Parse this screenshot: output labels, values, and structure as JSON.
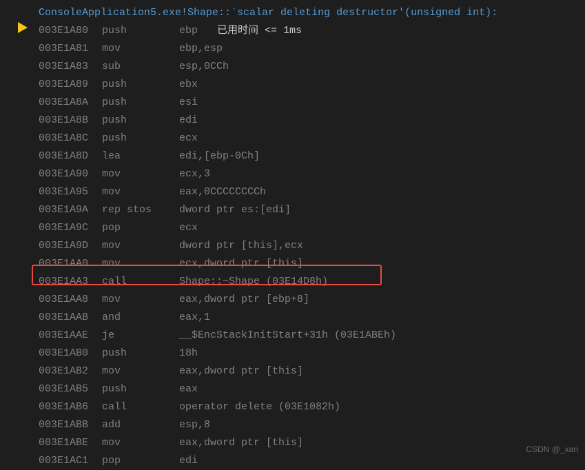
{
  "header": "ConsoleApplication5.exe!Shape::`scalar deleting destructor'(unsigned int):",
  "annotation": "已用时间 <= 1ms",
  "watermark": "CSDN @_xan",
  "rows": [
    {
      "addr": "003E1A80",
      "mn": "push",
      "op": "ebp"
    },
    {
      "addr": "003E1A81",
      "mn": "mov",
      "op": "ebp,esp"
    },
    {
      "addr": "003E1A83",
      "mn": "sub",
      "op": "esp,0CCh"
    },
    {
      "addr": "003E1A89",
      "mn": "push",
      "op": "ebx"
    },
    {
      "addr": "003E1A8A",
      "mn": "push",
      "op": "esi"
    },
    {
      "addr": "003E1A8B",
      "mn": "push",
      "op": "edi"
    },
    {
      "addr": "003E1A8C",
      "mn": "push",
      "op": "ecx"
    },
    {
      "addr": "003E1A8D",
      "mn": "lea",
      "op": "edi,[ebp-0Ch]"
    },
    {
      "addr": "003E1A90",
      "mn": "mov",
      "op": "ecx,3"
    },
    {
      "addr": "003E1A95",
      "mn": "mov",
      "op": "eax,0CCCCCCCCh"
    },
    {
      "addr": "003E1A9A",
      "mn": "rep stos",
      "op": "dword ptr es:[edi]"
    },
    {
      "addr": "003E1A9C",
      "mn": "pop",
      "op": "ecx"
    },
    {
      "addr": "003E1A9D",
      "mn": "mov",
      "op": "dword ptr [this],ecx"
    },
    {
      "addr": "003E1AA0",
      "mn": "mov",
      "op": "ecx,dword ptr [this]"
    },
    {
      "addr": "003E1AA3",
      "mn": "call",
      "op": "Shape::~Shape (03E14D8h)"
    },
    {
      "addr": "003E1AA8",
      "mn": "mov",
      "op": "eax,dword ptr [ebp+8]"
    },
    {
      "addr": "003E1AAB",
      "mn": "and",
      "op": "eax,1"
    },
    {
      "addr": "003E1AAE",
      "mn": "je",
      "op": "__$EncStackInitStart+31h (03E1ABEh)"
    },
    {
      "addr": "003E1AB0",
      "mn": "push",
      "op": "18h"
    },
    {
      "addr": "003E1AB2",
      "mn": "mov",
      "op": "eax,dword ptr [this]"
    },
    {
      "addr": "003E1AB5",
      "mn": "push",
      "op": "eax"
    },
    {
      "addr": "003E1AB6",
      "mn": "call",
      "op": "operator delete (03E1082h)"
    },
    {
      "addr": "003E1ABB",
      "mn": "add",
      "op": "esp,8"
    },
    {
      "addr": "003E1ABE",
      "mn": "mov",
      "op": "eax,dword ptr [this]"
    },
    {
      "addr": "003E1AC1",
      "mn": "pop",
      "op": "edi"
    }
  ]
}
